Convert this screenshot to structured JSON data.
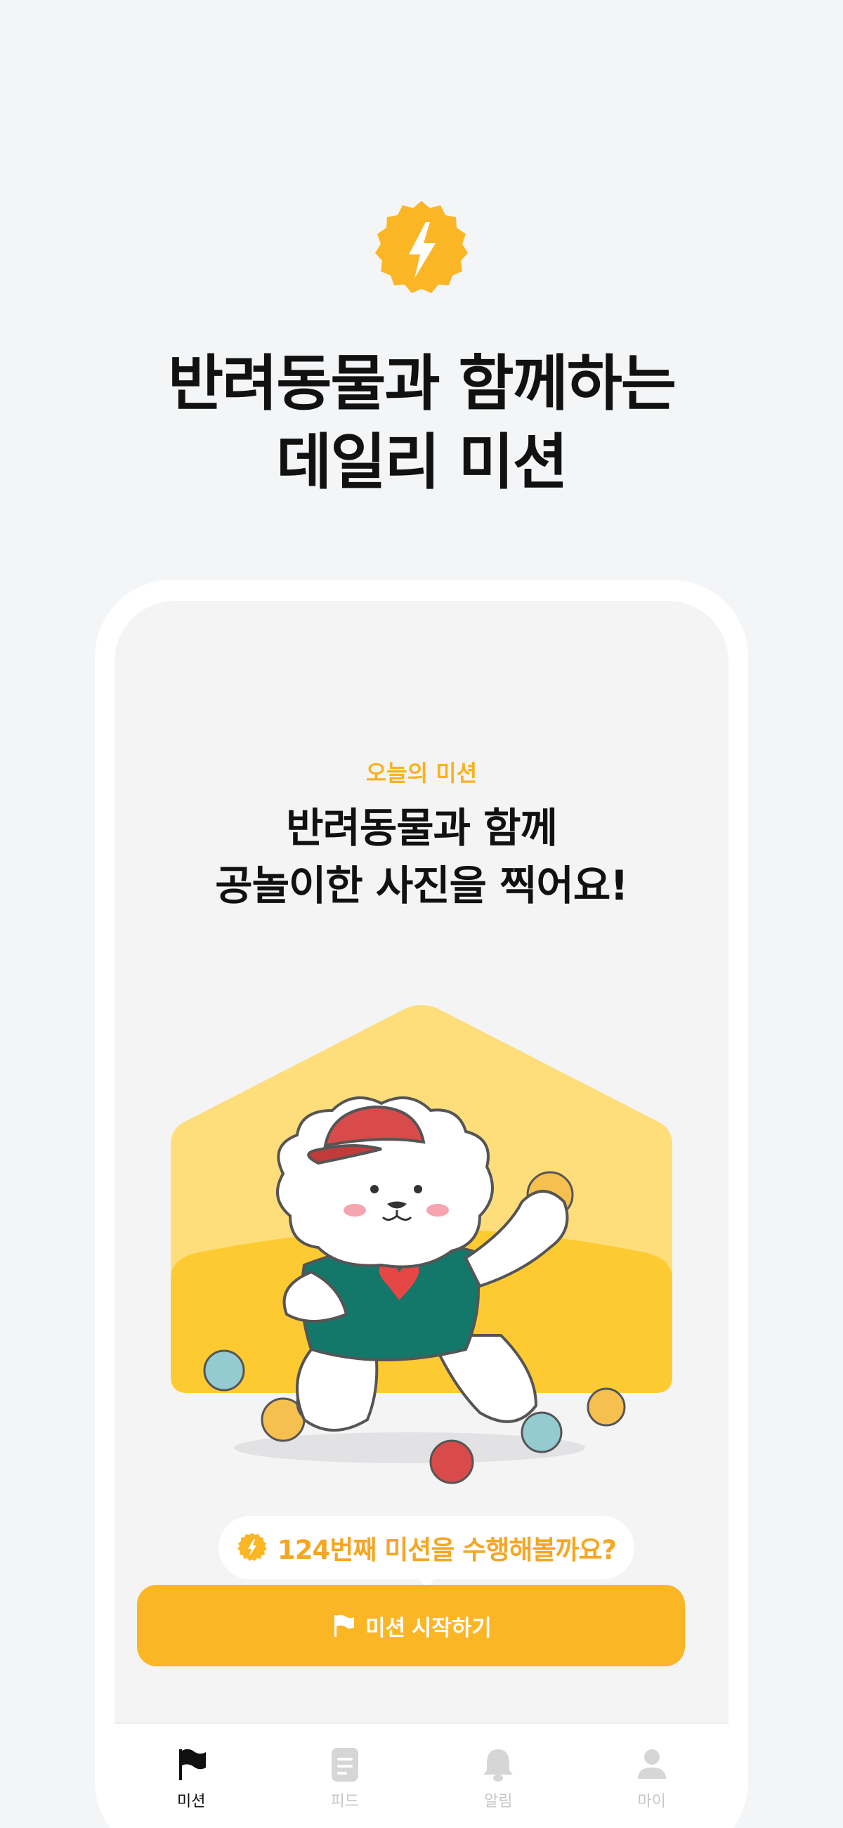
{
  "hero": {
    "title_line1": "반려동물과 함께하는",
    "title_line2": "데일리 미션",
    "badge_icon": "lightning-badge-icon"
  },
  "mission": {
    "kicker": "오늘의 미션",
    "title_line1": "반려동물과 함께",
    "title_line2": "공놀이한 사진을 찍어요!",
    "illustration": "dog-playing-ball-illustration"
  },
  "bubble": {
    "text": "124번째 미션을 수행해볼까요?",
    "icon": "lightning-icon"
  },
  "start_button": {
    "label": "미션 시작하기",
    "icon": "flag-icon"
  },
  "tabs": [
    {
      "label": "미션",
      "icon": "flag-icon",
      "active": true
    },
    {
      "label": "피드",
      "icon": "document-icon",
      "active": false
    },
    {
      "label": "알림",
      "icon": "bell-icon",
      "active": false
    },
    {
      "label": "마이",
      "icon": "person-icon",
      "active": false
    }
  ],
  "colors": {
    "accent": "#fbb626",
    "accent_text": "#f5a623",
    "background": "#f4f5f7"
  }
}
